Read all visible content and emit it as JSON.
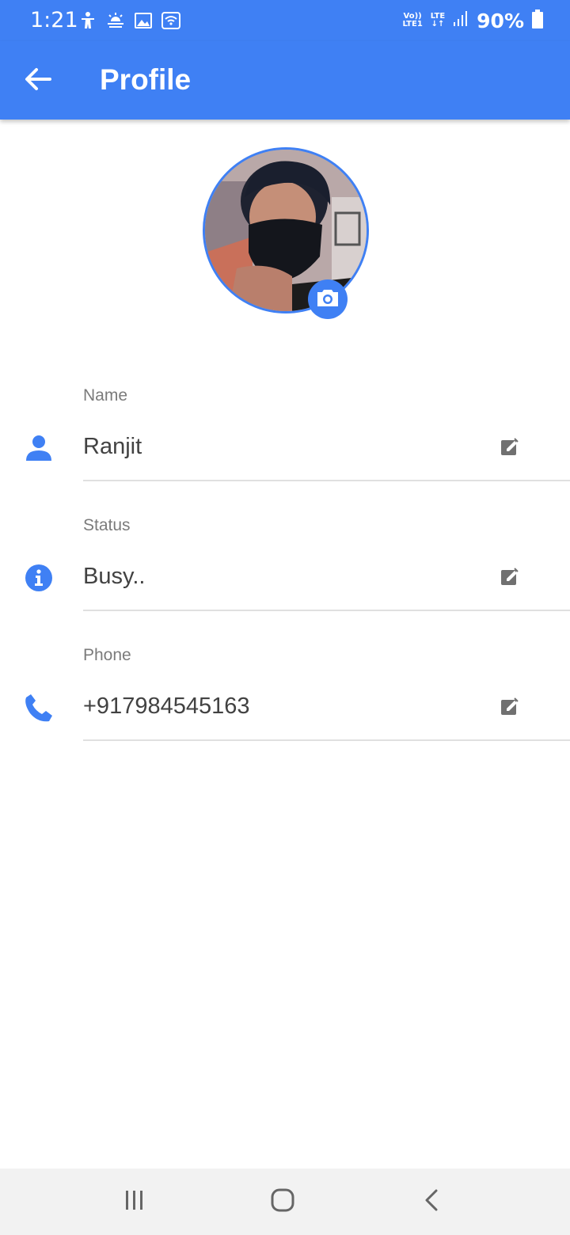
{
  "status_bar": {
    "time": "1:21",
    "volte_top": "Vo))",
    "volte_bottom": "LTE1",
    "network": "LTE",
    "battery": "90%",
    "icons": [
      "accessibility-icon",
      "weather-icon",
      "gallery-icon",
      "wifi-icon",
      "signal-icon",
      "battery-icon"
    ]
  },
  "app_bar": {
    "title": "Profile",
    "back_icon": "arrow-left-icon"
  },
  "profile": {
    "camera_icon": "camera-icon"
  },
  "fields": [
    {
      "label": "Name",
      "value": "Ranjit",
      "icon": "person-icon"
    },
    {
      "label": "Status",
      "value": "Busy..",
      "icon": "info-icon"
    },
    {
      "label": "Phone",
      "value": "+917984545163",
      "icon": "phone-icon"
    }
  ],
  "nav_bar": {
    "icons": [
      "recent-apps-icon",
      "home-icon",
      "back-icon"
    ]
  },
  "colors": {
    "primary": "#3f80f4",
    "background": "#ffffff",
    "label": "#7b7b7b",
    "value": "#424242",
    "divider": "#e0e0e0"
  }
}
